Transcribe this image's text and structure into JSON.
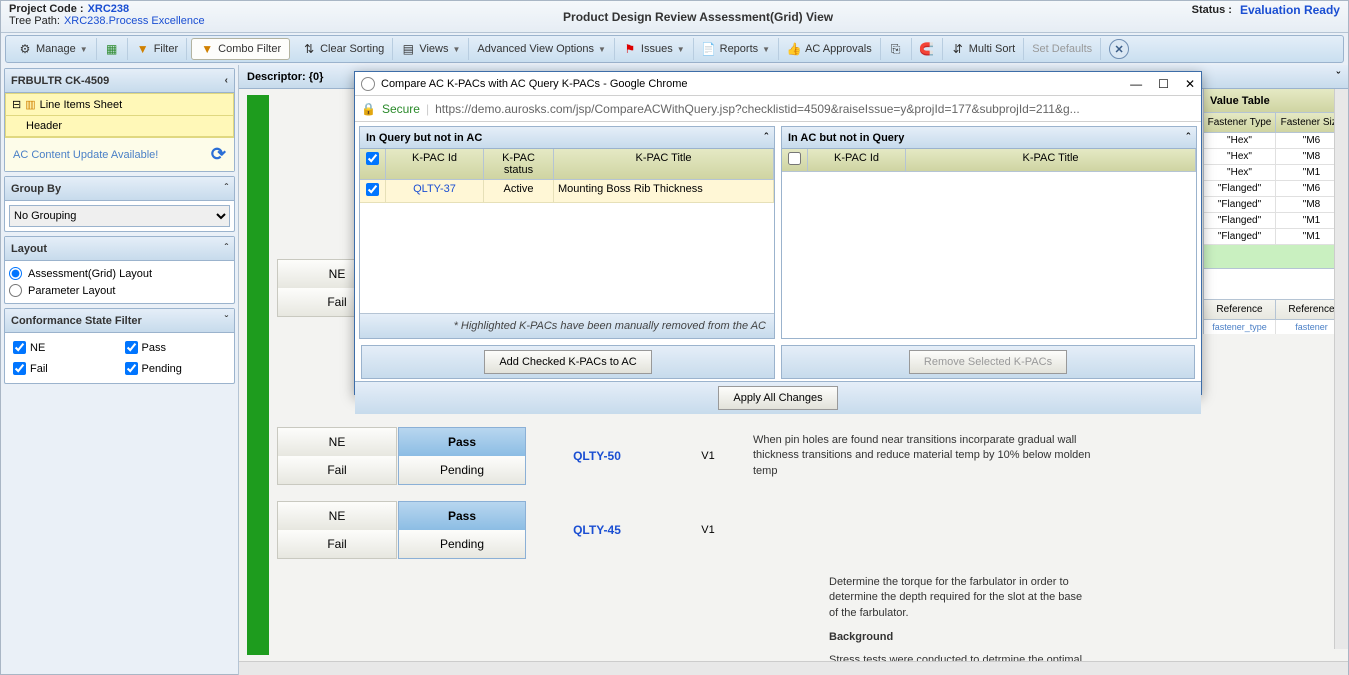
{
  "header": {
    "project_label": "Project Code  :",
    "project_code": "XRC238",
    "tree_label": "Tree Path:",
    "tree_path": "XRC238.Process Excellence",
    "title": "Product Design Review Assessment(Grid) View",
    "status_label": "Status   :",
    "status_value": "Evaluation Ready"
  },
  "toolbar": {
    "manage": "Manage",
    "filter": "Filter",
    "combo": "Combo Filter",
    "clear_sort": "Clear Sorting",
    "views": "Views",
    "adv": "Advanced View Options",
    "issues": "Issues",
    "reports": "Reports",
    "approvals": "AC Approvals",
    "multi_sort": "Multi Sort",
    "defaults": "Set Defaults"
  },
  "sidebar": {
    "panel_title": "FRBULTR CK-4509",
    "line_items": "Line Items Sheet",
    "header_node": "Header",
    "update_msg": "AC Content Update Available!",
    "group_by": "Group By",
    "grouping_val": "No Grouping",
    "layout": "Layout",
    "layout_radio1": "Assessment(Grid) Layout",
    "layout_radio2": "Parameter Layout",
    "conf_filter": "Conformance State Filter",
    "cb_ne": "NE",
    "cb_pass": "Pass",
    "cb_fail": "Fail",
    "cb_pending": "Pending"
  },
  "content": {
    "descriptor": "Descriptor: {0}",
    "ne": "NE",
    "fail": "Fail",
    "pass": "Pass",
    "pending": "Pending",
    "row3": {
      "kpac": "QLTY-50",
      "ver": "V1",
      "text": "When pin holes are found near transitions incorparate gradual wall thickness transitions and reduce material temp by 10% below molden temp"
    },
    "row4": {
      "kpac": "QLTY-45",
      "ver": "V1"
    },
    "row5": {
      "text": "Determine the torque for the farbulator in order to determine the depth required for the slot at the base of the farbulator.",
      "bg": "Background",
      "stress": "Stress tests were conducted to detrmine the optimal"
    }
  },
  "value_table": {
    "title": "Value Table",
    "th1": "Fastener Type",
    "th2": "Fastener Size",
    "rows": [
      {
        "t": "\"Hex\"",
        "s": "\"M6"
      },
      {
        "t": "\"Hex\"",
        "s": "\"M8"
      },
      {
        "t": "\"Hex\"",
        "s": "\"M1"
      },
      {
        "t": "\"Flanged\"",
        "s": "\"M6"
      },
      {
        "t": "\"Flanged\"",
        "s": "\"M8"
      },
      {
        "t": "\"Flanged\"",
        "s": "\"M1"
      },
      {
        "t": "\"Flanged\"",
        "s": "\"M1"
      }
    ],
    "ref1": "Reference",
    "ref2": "Reference",
    "sub1": "fastener_type",
    "sub2": "fastener"
  },
  "dialog": {
    "win_title": "Compare AC K-PACs with AC Query K-PACs - Google Chrome",
    "secure": "Secure",
    "url": "https://demo.aurosks.com/jsp/CompareACWithQuery.jsp?checklistid=4509&raiseIssue=y&projId=177&subprojId=211&g...",
    "left_title": "In Query but not in AC",
    "right_title": "In AC but not in Query",
    "col_id": "K-PAC Id",
    "col_status": "K-PAC status",
    "col_title": "K-PAC Title",
    "row": {
      "id": "QLTY-37",
      "status": "Active",
      "title": "Mounting Boss Rib Thickness"
    },
    "note": "* Highlighted K-PACs have been manually removed from the AC",
    "btn_add": "Add Checked K-PACs to AC",
    "btn_remove": "Remove Selected K-PACs",
    "btn_apply": "Apply All Changes"
  }
}
